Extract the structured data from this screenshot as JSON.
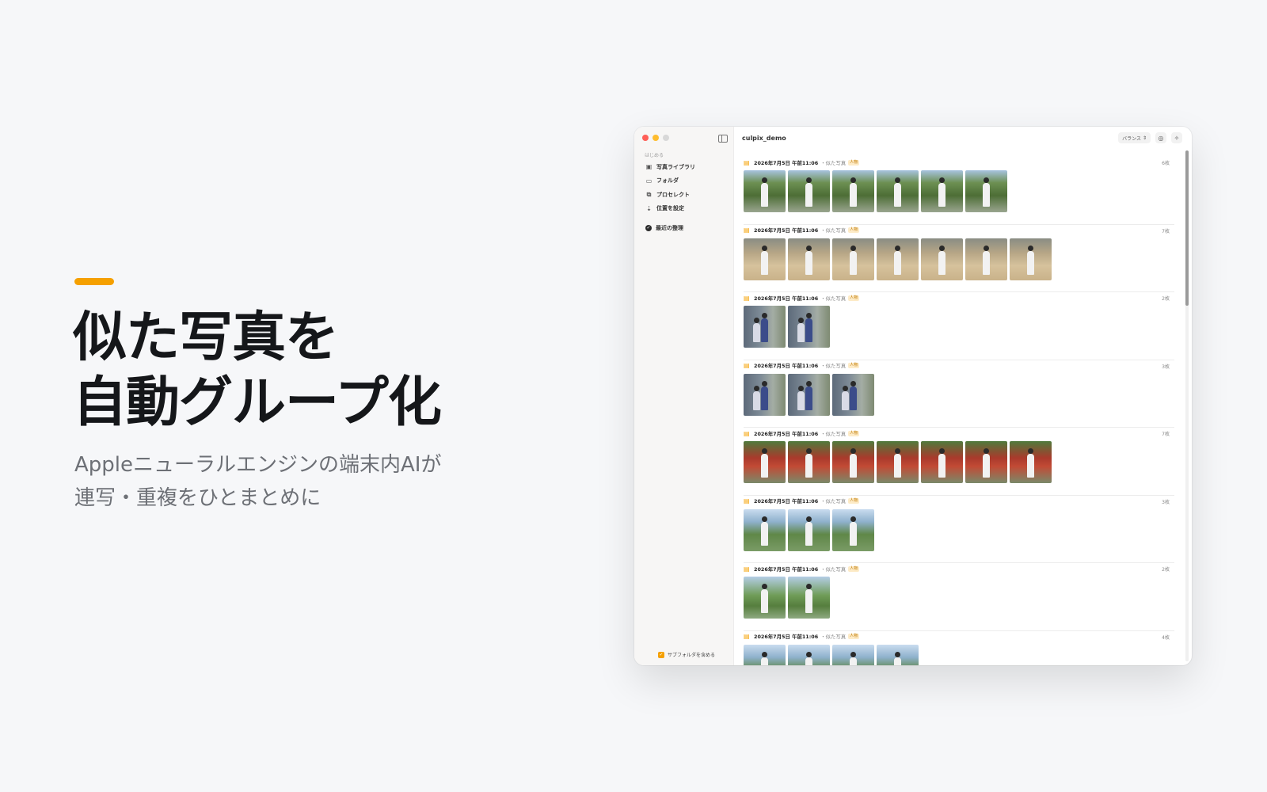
{
  "hero": {
    "headline_line1": "似た写真を",
    "headline_line2": "自動グループ化",
    "sub_line1": "Appleニューラルエンジンの端末内AIが",
    "sub_line2": "連写・重複をひとまとめに",
    "accent_color": "#f5a000"
  },
  "window": {
    "title": "culpix_demo",
    "sort_label": "バランス",
    "toolbar_icons": [
      "filter-icon",
      "sparkle-icon"
    ]
  },
  "sidebar": {
    "section_label": "はじめる",
    "items": [
      {
        "label": "写真ライブラリ",
        "icon": "photos-icon"
      },
      {
        "label": "フォルダ",
        "icon": "folder-icon"
      },
      {
        "label": "プロセレクト",
        "icon": "proselect-icon"
      },
      {
        "label": "位置を設定",
        "icon": "location-icon"
      }
    ],
    "recent_label": "最近の整理",
    "subfolder_label": "サブフォルダを含める"
  },
  "groups": [
    {
      "date": "2026年7月5日 午前11:06",
      "similar": "・似た写真",
      "tag": "人物",
      "count": "6枚",
      "scene": "garden",
      "thumbs": 6
    },
    {
      "date": "2026年7月5日 午前11:06",
      "similar": "・似た写真",
      "tag": "人物",
      "count": "7枚",
      "scene": "court",
      "thumbs": 7
    },
    {
      "date": "2026年7月5日 午前11:06",
      "similar": "・似た写真",
      "tag": "人物",
      "count": "2枚",
      "scene": "tree",
      "thumbs": 2
    },
    {
      "date": "2026年7月5日 午前11:06",
      "similar": "・似た写真",
      "tag": "人物",
      "count": "3枚",
      "scene": "tree",
      "thumbs": 3
    },
    {
      "date": "2026年7月5日 午前11:06",
      "similar": "・似た写真",
      "tag": "人物",
      "count": "7枚",
      "scene": "shrine",
      "thumbs": 7
    },
    {
      "date": "2026年7月5日 午前11:06",
      "similar": "・似た写真",
      "tag": "人物",
      "count": "3枚",
      "scene": "lake",
      "thumbs": 3
    },
    {
      "date": "2026年7月5日 午前11:06",
      "similar": "・似た写真",
      "tag": "人物",
      "count": "2枚",
      "scene": "lake2",
      "thumbs": 2
    },
    {
      "date": "2026年7月5日 午前11:06",
      "similar": "・似た写真",
      "tag": "人物",
      "count": "4枚",
      "scene": "lake",
      "thumbs": 4
    }
  ]
}
